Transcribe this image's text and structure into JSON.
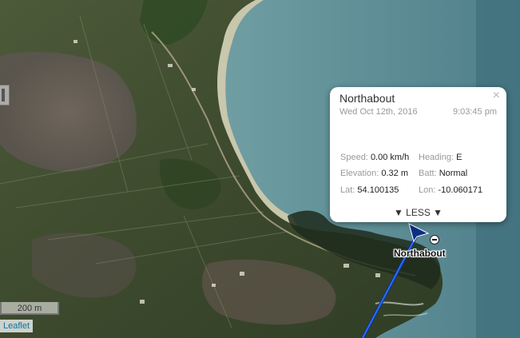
{
  "popup": {
    "title": "Northabout",
    "date": "Wed Oct 12th, 2016",
    "time": "9:03:45 pm",
    "close_label": "×",
    "speed_label": "Speed:",
    "speed_value": "0.00 km/h",
    "heading_label": "Heading:",
    "heading_value": "E",
    "elevation_label": "Elevation:",
    "elevation_value": "0.32 m",
    "batt_label": "Batt:",
    "batt_value": "Normal",
    "lat_label": "Lat:",
    "lat_value": "54.100135",
    "lon_label": "Lon:",
    "lon_value": "-10.060171",
    "less_label": "▼ LESS ▼"
  },
  "marker": {
    "label": "Northabout",
    "icon": "arrow-marker-icon",
    "track_color": "#1a5ad8"
  },
  "scale": {
    "label": "200 m"
  },
  "attribution": {
    "label": "Leaflet"
  },
  "colors": {
    "sea": "#5f8d93",
    "land": "#3a4a2c",
    "beach": "#d8cfae"
  }
}
